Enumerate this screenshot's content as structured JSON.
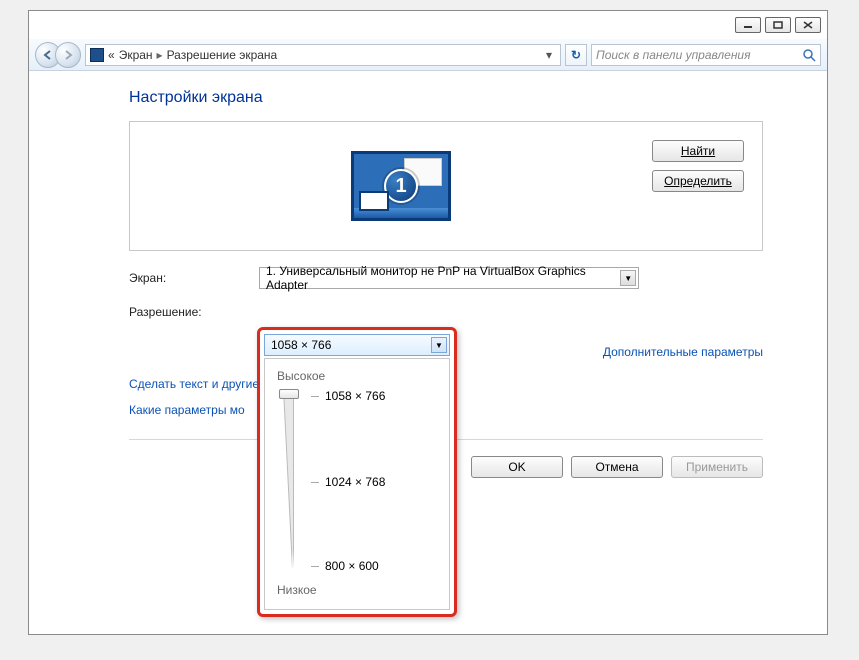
{
  "breadcrumb": {
    "root": "Экран",
    "page": "Разрешение экрана"
  },
  "search": {
    "placeholder": "Поиск в панели управления"
  },
  "page_title": "Настройки экрана",
  "monitor": {
    "badge": "1",
    "find_btn": "Найти",
    "detect_btn": "Определить"
  },
  "form": {
    "display_label": "Экран:",
    "display_value": "1. Универсальный монитор не PnP на VirtualBox Graphics Adapter",
    "resolution_label": "Разрешение:",
    "resolution_value": "1058 × 766"
  },
  "adv_link": "Дополнительные параметры",
  "help1": "Сделать текст и другие",
  "help2": "Какие параметры мо",
  "buttons": {
    "ok": "OK",
    "cancel": "Отмена",
    "apply": "Применить"
  },
  "res_popup": {
    "header": "1058 × 766",
    "high": "Высокое",
    "low": "Низкое",
    "options": [
      "1058 × 766",
      "1024 × 768",
      "800 × 600"
    ]
  }
}
